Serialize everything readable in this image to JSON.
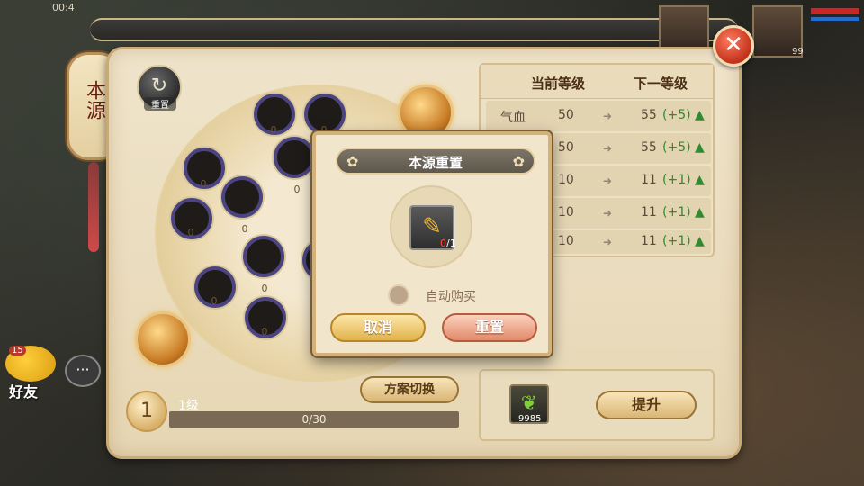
{
  "hud": {
    "time": "00:4",
    "avatar_level": "99"
  },
  "side": {
    "lantern_text": "本源",
    "friend_label": "好友",
    "friend_badge": "15",
    "chat_icon": "···"
  },
  "panel": {
    "reset_label": "重置",
    "nodes": [
      "0",
      "0",
      "0",
      "0",
      "0",
      "0",
      "0",
      "0",
      "0",
      "0"
    ],
    "level_num": "1",
    "level_label": "1级",
    "exp_text": "0/30",
    "plan_switch_label": "方案切换",
    "upgrade_label": "提升",
    "item_count": "9985"
  },
  "stats": {
    "header_current": "当前等级",
    "header_next": "下一等级",
    "rows": [
      {
        "name": "气血",
        "current": "50",
        "next": "55",
        "bonus": "(+5)"
      },
      {
        "name": "",
        "current": "50",
        "next": "55",
        "bonus": "(+5)"
      },
      {
        "name": "",
        "current": "10",
        "next": "11",
        "bonus": "(+1)"
      },
      {
        "name": "",
        "current": "10",
        "next": "11",
        "bonus": "(+1)"
      },
      {
        "name": "",
        "current": "10",
        "next": "11",
        "bonus": "(+1)"
      }
    ]
  },
  "dialog": {
    "title": "本源重置",
    "item_have": "0",
    "item_need": "/1",
    "auto_buy_label": "自动购买",
    "cancel_label": "取消",
    "confirm_label": "重置"
  },
  "colors": {
    "accent_gold": "#d2b27a",
    "bonus_green": "#2e8b2e",
    "close_red": "#c2321b"
  }
}
